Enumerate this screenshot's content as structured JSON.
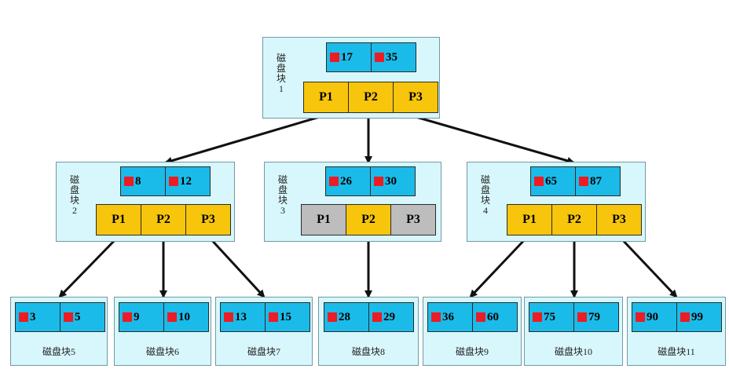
{
  "colors": {
    "block_bg": "#d8f7fc",
    "key_bg": "#1bbbe9",
    "pointer_bg": "#f7c50c",
    "pointer_unused_bg": "#bdbdbd",
    "key_marker": "#ec1b24",
    "edge": "#111111"
  },
  "icons": {
    "key_marker": "red-square-icon",
    "edge_head": "arrowhead-icon"
  },
  "root": {
    "label": "磁盘块1",
    "keys": [
      "17",
      "35"
    ],
    "pointers": [
      "P1",
      "P2",
      "P3"
    ]
  },
  "internal": [
    {
      "label": "磁盘块2",
      "keys": [
        "8",
        "12"
      ],
      "pointers": [
        "P1",
        "P2",
        "P3"
      ]
    },
    {
      "label": "磁盘块3",
      "keys": [
        "26",
        "30"
      ],
      "pointers": [
        "P1",
        "P2",
        "P3"
      ]
    },
    {
      "label": "磁盘块4",
      "keys": [
        "65",
        "87"
      ],
      "pointers": [
        "P1",
        "P2",
        "P3"
      ]
    }
  ],
  "leaves": [
    {
      "label": "磁盘块5",
      "keys": [
        "3",
        "5"
      ]
    },
    {
      "label": "磁盘块6",
      "keys": [
        "9",
        "10"
      ]
    },
    {
      "label": "磁盘块7",
      "keys": [
        "13",
        "15"
      ]
    },
    {
      "label": "磁盘块8",
      "keys": [
        "28",
        "29"
      ]
    },
    {
      "label": "磁盘块9",
      "keys": [
        "36",
        "60"
      ]
    },
    {
      "label": "磁盘块10",
      "keys": [
        "75",
        "79"
      ]
    },
    {
      "label": "磁盘块11",
      "keys": [
        "90",
        "99"
      ]
    }
  ]
}
